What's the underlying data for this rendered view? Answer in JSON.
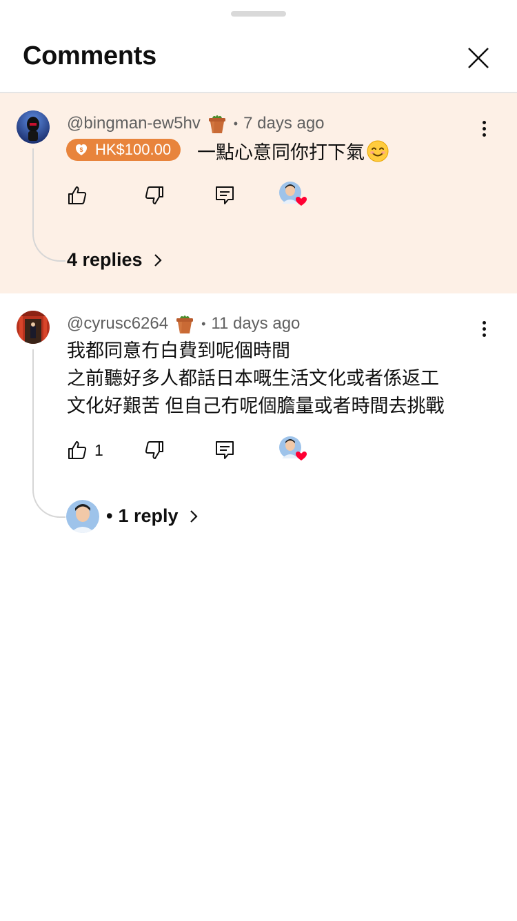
{
  "header": {
    "title": "Comments",
    "close_icon": "close-icon"
  },
  "comments": [
    {
      "author": "@bingman-ew5hv",
      "badge_icon": "plant-pot-badge-icon",
      "separator": "•",
      "time": "7 days ago",
      "super_chat": {
        "amount": "HK$100.00",
        "color": "#e8843c",
        "icon": "coin-icon"
      },
      "text": "一點心意同你打下氣",
      "text_emoji": "smiling-face-icon",
      "likes": "",
      "creator_heart": true,
      "replies_label": "4 replies",
      "highlight_bg": "#fdf0e6"
    },
    {
      "author": "@cyrusc6264",
      "badge_icon": "plant-pot-badge-icon",
      "separator": "•",
      "time": "11 days ago",
      "lines": [
        "我都同意冇白費到呢個時間",
        "之前聽好多人都話日本嘅生活文化或者係返工",
        "文化好艱苦 但自己冇呢個膽量或者時間去挑戰"
      ],
      "likes": "1",
      "creator_heart": true,
      "replies_prefix": "•",
      "replies_label": "1 reply"
    }
  ]
}
